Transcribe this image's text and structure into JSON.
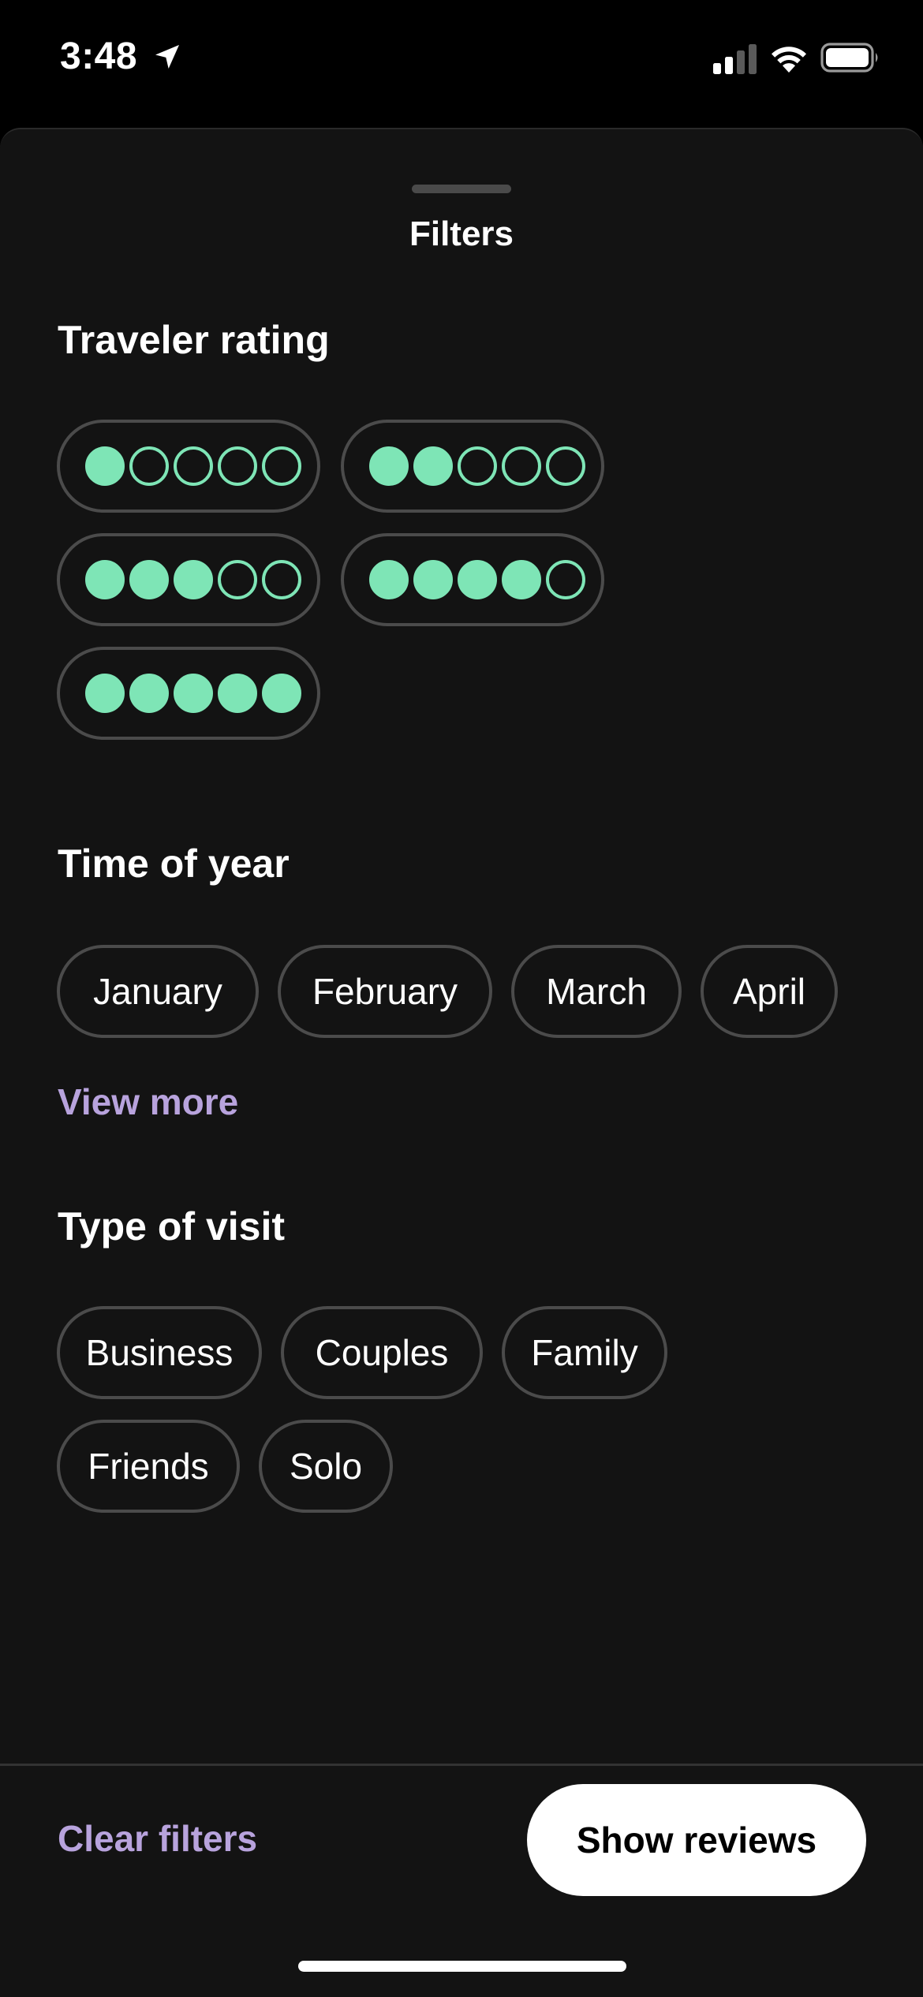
{
  "status_bar": {
    "time": "3:48",
    "icons": [
      "location-arrow-icon",
      "signal-icon",
      "wifi-icon",
      "battery-icon"
    ]
  },
  "sheet": {
    "title": "Filters"
  },
  "traveler_rating": {
    "heading": "Traveler rating",
    "options": [
      {
        "filled": 1,
        "total": 5
      },
      {
        "filled": 2,
        "total": 5
      },
      {
        "filled": 3,
        "total": 5
      },
      {
        "filled": 4,
        "total": 5
      },
      {
        "filled": 5,
        "total": 5
      }
    ]
  },
  "time_of_year": {
    "heading": "Time of year",
    "months": [
      "January",
      "February",
      "March",
      "April"
    ],
    "view_more": "View more"
  },
  "type_of_visit": {
    "heading": "Type of visit",
    "types": [
      "Business",
      "Couples",
      "Family",
      "Friends",
      "Solo"
    ]
  },
  "footer": {
    "clear_label": "Clear filters",
    "show_label": "Show reviews"
  },
  "colors": {
    "background": "#131313",
    "rating_dot": "#7ee5b6",
    "link": "#b8a3dd",
    "chip_border": "#4b4b4b",
    "primary_button": "#ffffff"
  }
}
